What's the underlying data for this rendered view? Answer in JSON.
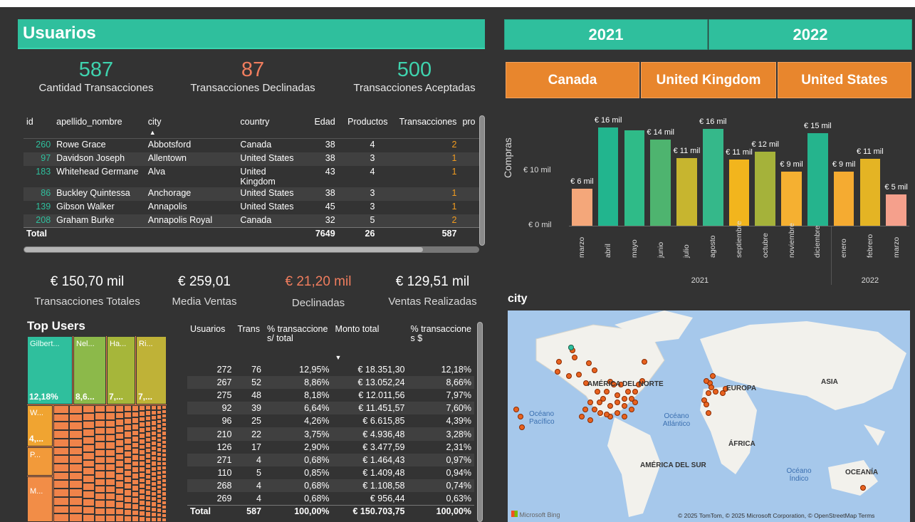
{
  "title": "Usuarios",
  "years": [
    "2021",
    "2022"
  ],
  "countries": [
    "Canada",
    "United Kingdom",
    "United States"
  ],
  "kpis_top": [
    {
      "value": "587",
      "label": "Cantidad Transacciones",
      "color": "#3fd3ae"
    },
    {
      "value": "87",
      "label": "Transacciones Declinadas",
      "color": "#f07d5e"
    },
    {
      "value": "500",
      "label": "Transacciones Aceptadas",
      "color": "#3fd3ae"
    }
  ],
  "users_table": {
    "headers": [
      "id",
      "apellido_nombre",
      "city",
      "country",
      "Edad",
      "Productos",
      "Transacciones",
      "pro"
    ],
    "rows": [
      [
        "260",
        "Rowe Grace",
        "Abbotsford",
        "Canada",
        "38",
        "4",
        "2"
      ],
      [
        "97",
        "Davidson Joseph",
        "Allentown",
        "United States",
        "38",
        "3",
        "1"
      ],
      [
        "183",
        "Whitehead Germane",
        "Alva",
        "United Kingdom",
        "43",
        "4",
        "1"
      ],
      [
        "86",
        "Buckley Quintessa",
        "Anchorage",
        "United States",
        "38",
        "3",
        "1"
      ],
      [
        "139",
        "Gibson Walker",
        "Annapolis",
        "United States",
        "45",
        "3",
        "1"
      ],
      [
        "208",
        "Graham Burke",
        "Annapolis Royal",
        "Canada",
        "32",
        "5",
        "2"
      ]
    ],
    "total": {
      "label": "Total",
      "edad": "7649",
      "productos": "26",
      "transacciones": "587"
    }
  },
  "kpis_mid": [
    {
      "value": "€ 150,70 mil",
      "label": "Transacciones Totales",
      "color": "#ffffff"
    },
    {
      "value": "€ 259,01",
      "label": "Media Ventas",
      "color": "#ffffff"
    },
    {
      "value": "€ 21,20 mil",
      "label": "Declinadas",
      "color": "#f07d5e"
    },
    {
      "value": "€ 129,51 mil",
      "label": "Ventas Realizadas",
      "color": "#ffffff"
    }
  ],
  "top_users": {
    "title": "Top Users",
    "tiles": [
      {
        "label": "Gilbert...",
        "pct": "12,18%",
        "color": "#2fbf9d"
      },
      {
        "label": "Nel...",
        "pct": "8,6...",
        "color": "#8cb94a"
      },
      {
        "label": "Ha...",
        "pct": "7,...",
        "color": "#a6b63a"
      },
      {
        "label": "Ri...",
        "pct": "7,...",
        "color": "#bfb237"
      },
      {
        "label": "W...",
        "pct": "4,...",
        "color": "#f0a431"
      },
      {
        "label": "P...",
        "pct": "",
        "color": "#f29a3a"
      },
      {
        "label": "M...",
        "pct": "",
        "color": "#f28d47"
      }
    ]
  },
  "users_sum_table": {
    "headers": [
      "Usuarios",
      "Trans",
      "% transaccione s/ total",
      "Monto total",
      "% transaccione s $"
    ],
    "rows": [
      [
        "272",
        "76",
        "12,95%",
        "€ 18.351,30",
        "12,18%"
      ],
      [
        "267",
        "52",
        "8,86%",
        "€ 13.052,24",
        "8,66%"
      ],
      [
        "275",
        "48",
        "8,18%",
        "€ 12.011,56",
        "7,97%"
      ],
      [
        "92",
        "39",
        "6,64%",
        "€ 11.451,57",
        "7,60%"
      ],
      [
        "96",
        "25",
        "4,26%",
        "€ 6.615,85",
        "4,39%"
      ],
      [
        "210",
        "22",
        "3,75%",
        "€ 4.936,48",
        "3,28%"
      ],
      [
        "126",
        "17",
        "2,90%",
        "€ 3.477,59",
        "2,31%"
      ],
      [
        "271",
        "4",
        "0,68%",
        "€ 1.464,43",
        "0,97%"
      ],
      [
        "110",
        "5",
        "0,85%",
        "€ 1.409,48",
        "0,94%"
      ],
      [
        "268",
        "4",
        "0,68%",
        "€ 1.108,58",
        "0,74%"
      ],
      [
        "269",
        "4",
        "0,68%",
        "€ 956,44",
        "0,63%"
      ]
    ],
    "total": [
      "Total",
      "587",
      "100,00%",
      "€ 150.703,75",
      "100,00%"
    ]
  },
  "chart_data": {
    "type": "bar",
    "ylabel": "Compras",
    "yticks": [
      "€ 10 mil",
      "€ 0 mil"
    ],
    "ylim": [
      0,
      17000
    ],
    "categories": [
      "marzo",
      "abril",
      "mayo",
      "junio",
      "julio",
      "agosto",
      "septiembre",
      "octubre",
      "noviembre",
      "diciembre",
      "enero",
      "febrero",
      "marzo"
    ],
    "groups": [
      {
        "label": "2021",
        "count": 10
      },
      {
        "label": "2022",
        "count": 3
      }
    ],
    "values": [
      6000,
      16000,
      15500,
      14000,
      11000,
      15700,
      10800,
      12000,
      8800,
      15000,
      8800,
      10900,
      5100
    ],
    "data_labels": [
      "€ 6 mil",
      "€ 16 mil",
      "",
      "€ 14 mil",
      "€ 11 mil",
      "€ 16 mil",
      "€ 11 mil",
      "€ 12 mil",
      "€ 9 mil",
      "€ 15 mil",
      "€ 9 mil",
      "€ 11 mil",
      "€ 5 mil"
    ],
    "colors": [
      "#f4a77a",
      "#22b58e",
      "#2fbb88",
      "#4eb46f",
      "#c7b52f",
      "#35b88a",
      "#f2b51d",
      "#a5b23a",
      "#f5b031",
      "#25b48d",
      "#f5ab31",
      "#e4b424",
      "#f5a08c"
    ]
  },
  "map": {
    "title": "city",
    "labels": [
      "AMÉRICA DEL NORTE",
      "EUROPA",
      "ASIA",
      "ÁFRICA",
      "AMÉRICA DEL SUR",
      "OCEANÍA"
    ],
    "oceans": [
      "Océano Pacífico",
      "Océano Atlántico",
      "Océano Índico"
    ],
    "attribution": "© 2025 TomTom, © 2025 Microsoft Corporation, © OpenStreetMap  Terms",
    "brand": "Microsoft Bing"
  }
}
